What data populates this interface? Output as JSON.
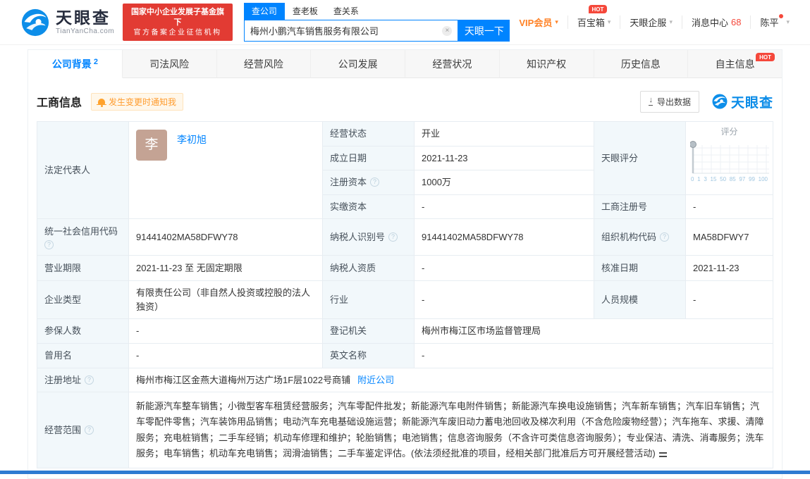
{
  "icons": {
    "help_glyph": "?",
    "caret_glyph": "▾",
    "clear_glyph": "×",
    "download_glyph": "↓"
  },
  "colors": {
    "accent": "#0084ff",
    "brand_blue": "#0b8ce8",
    "alert_red": "#f5483b",
    "gov_red": "#e23b33",
    "vip_orange": "#ff8125"
  },
  "header": {
    "logo_title": "天眼查",
    "logo_domain": "TianYanCha.com",
    "gov_badge_line1": "国家中小企业发展子基金旗下",
    "gov_badge_line2": "官方备案企业征信机构",
    "search": {
      "tabs": [
        "查公司",
        "查老板",
        "查关系"
      ],
      "value": "梅州小鹏汽车销售服务有限公司",
      "button": "天眼一下"
    },
    "menu": {
      "vip": "VIP会员",
      "toolbox": "百宝箱",
      "toolbox_badge": "HOT",
      "enterprise_service": "天眼企服",
      "message_center": "消息中心",
      "message_count": "68",
      "username": "陈平"
    }
  },
  "nav": {
    "tabs": [
      {
        "label": "公司背景",
        "count": "2"
      },
      {
        "label": "司法风险"
      },
      {
        "label": "经营风险"
      },
      {
        "label": "公司发展"
      },
      {
        "label": "经营状况"
      },
      {
        "label": "知识产权"
      },
      {
        "label": "历史信息"
      },
      {
        "label": "自主信息",
        "badge": "HOT"
      }
    ]
  },
  "section": {
    "title": "工商信息",
    "notify_label": "发生变更时通知我",
    "export_label": "导出数据",
    "brand": "天眼查"
  },
  "company": {
    "legal_rep": {
      "label": "法定代表人",
      "name": "李初旭",
      "avatar_char": "李"
    },
    "status": {
      "label": "经营状态",
      "value": "开业"
    },
    "established": {
      "label": "成立日期",
      "value": "2021-11-23"
    },
    "registered_capital": {
      "label": "注册资本",
      "value": "1000万"
    },
    "paid_in_capital": {
      "label": "实缴资本",
      "value": "-"
    },
    "tianyan_score": {
      "label": "天眼评分",
      "chart_title": "评分",
      "ticks": [
        "0",
        "1",
        "3",
        "15",
        "50",
        "85",
        "97",
        "99",
        "100"
      ]
    },
    "registration_number": {
      "label": "工商注册号",
      "value": "-"
    },
    "credit_code": {
      "label": "统一社会信用代码",
      "value": "91441402MA58DFWY78"
    },
    "taxpayer_id": {
      "label": "纳税人识别号",
      "value": "91441402MA58DFWY78"
    },
    "organization_code": {
      "label": "组织机构代码",
      "value": "MA58DFWY7"
    },
    "business_term": {
      "label": "营业期限",
      "value": "2021-11-23 至 无固定期限"
    },
    "taxpayer_qualification": {
      "label": "纳税人资质",
      "value": "-"
    },
    "approval_date": {
      "label": "核准日期",
      "value": "2021-11-23"
    },
    "company_type": {
      "label": "企业类型",
      "value": "有限责任公司（非自然人投资或控股的法人独资）"
    },
    "industry": {
      "label": "行业",
      "value": "-"
    },
    "staff_size": {
      "label": "人员规模",
      "value": "-"
    },
    "insured_staff": {
      "label": "参保人数",
      "value": "-"
    },
    "registration_authority": {
      "label": "登记机关",
      "value": "梅州市梅江区市场监督管理局"
    },
    "former_name": {
      "label": "曾用名",
      "value": "-"
    },
    "english_name": {
      "label": "英文名称",
      "value": "-"
    },
    "registered_address": {
      "label": "注册地址",
      "value": "梅州市梅江区金燕大道梅州万达广场1F层1022号商铺",
      "nearby_link": "附近公司"
    },
    "business_scope": {
      "label": "经营范围",
      "value": "新能源汽车整车销售；小微型客车租赁经营服务；汽车零配件批发；新能源汽车电附件销售；新能源汽车换电设施销售；汽车新车销售；汽车旧车销售；汽车零配件零售；汽车装饰用品销售；电动汽车充电基础设施运营；新能源汽车废旧动力蓄电池回收及梯次利用（不含危险废物经营）；汽车拖车、求援、清障服务；充电桩销售；二手车经销；机动车修理和维护；轮胎销售；电池销售；信息咨询服务（不含许可类信息咨询服务）；专业保洁、清洗、消毒服务；洗车服务；电车销售；机动车充电销售；润滑油销售；二手车鉴定评估。(依法须经批准的项目，经相关部门批准后方可开展经营活动)"
    }
  }
}
